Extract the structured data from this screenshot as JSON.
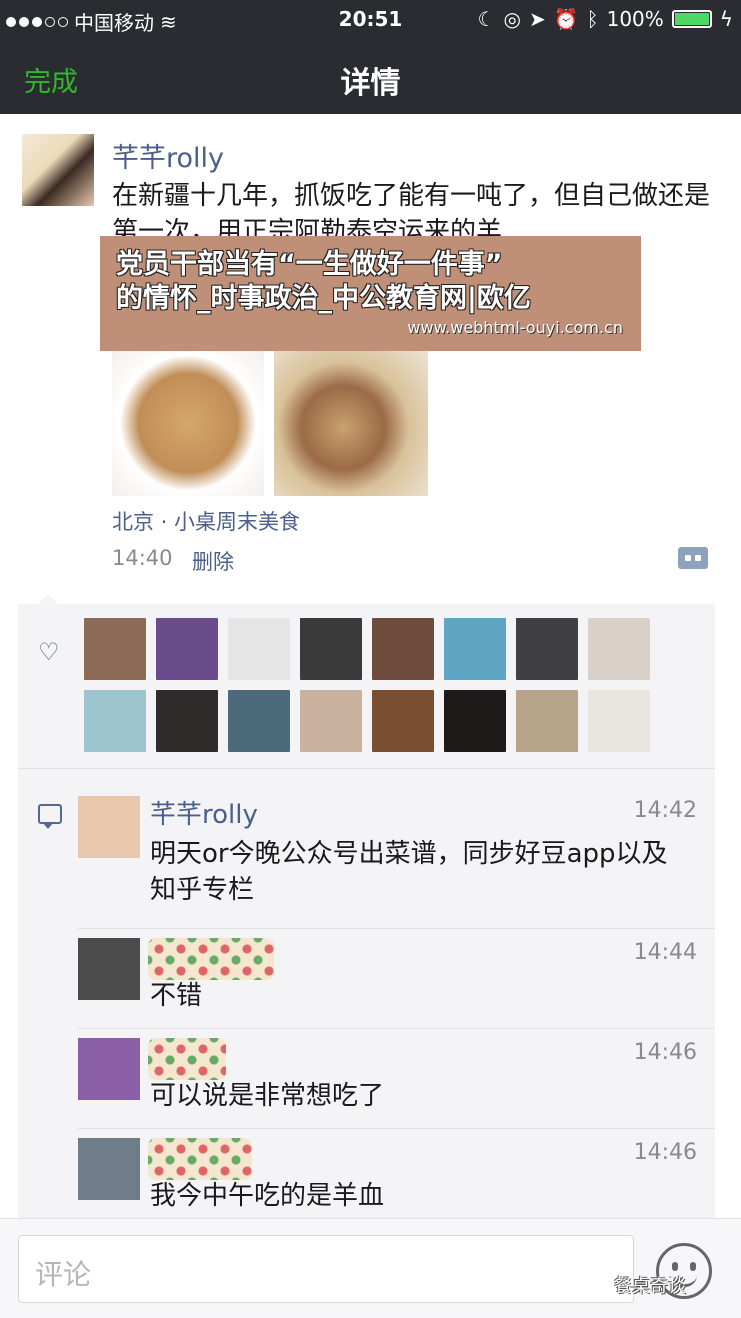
{
  "status": {
    "carrier": "中国移动",
    "time": "20:51",
    "battery": "100%"
  },
  "nav": {
    "done": "完成",
    "title": "详情"
  },
  "post": {
    "author": "芊芊rolly",
    "text": "在新疆十几年，抓饭吃了能有一吨了，但自己做还是第一次，用正宗阿勒泰空运来的羊",
    "overlay_title_lines": [
      "党员干部当有“一生做好一件事”",
      "的情怀_时事政治_中公教育网|欧亿"
    ],
    "overlay_url": "www.webhtml-ouyi.com.cn",
    "location": "北京 · 小桌周末美食",
    "time": "14:40",
    "delete": "删除"
  },
  "likes": {
    "avatars": [
      "#8b6b57",
      "#6a4b8c",
      "#e5e5e5",
      "#3a3a3a",
      "#6d4b3d",
      "#5ea6c4",
      "#3f3f44",
      "#d9d1c9",
      "#9ec4cf",
      "#2f2b2a",
      "#4d6a7c",
      "#c9b29d",
      "#7a4e31",
      "#1e1a1a",
      "#b7a48a",
      "#e9e6e0"
    ]
  },
  "comments": [
    {
      "name": "芊芊rolly",
      "time": "14:42",
      "text": "明天or今晚公众号出菜谱，同步好豆app以及知乎专栏",
      "avatar": "#e7c7ae"
    },
    {
      "name": "",
      "time": "14:44",
      "text": "不错",
      "avatar": "#4b4b4b"
    },
    {
      "name": "",
      "time": "14:46",
      "text": "可以说是非常想吃了",
      "avatar": "#8a5fa8"
    },
    {
      "name": "",
      "time": "14:46",
      "text": "我今中午吃的是羊血",
      "avatar": "#6f7d8a"
    }
  ],
  "input": {
    "placeholder": "评论"
  },
  "watermark": "餐桌奇谈",
  "colors": {
    "nav_bg": "#2b2c31",
    "done_green": "#2eb82e",
    "link_blue": "#4a5f8b",
    "panel_bg": "#f4f4f6"
  }
}
